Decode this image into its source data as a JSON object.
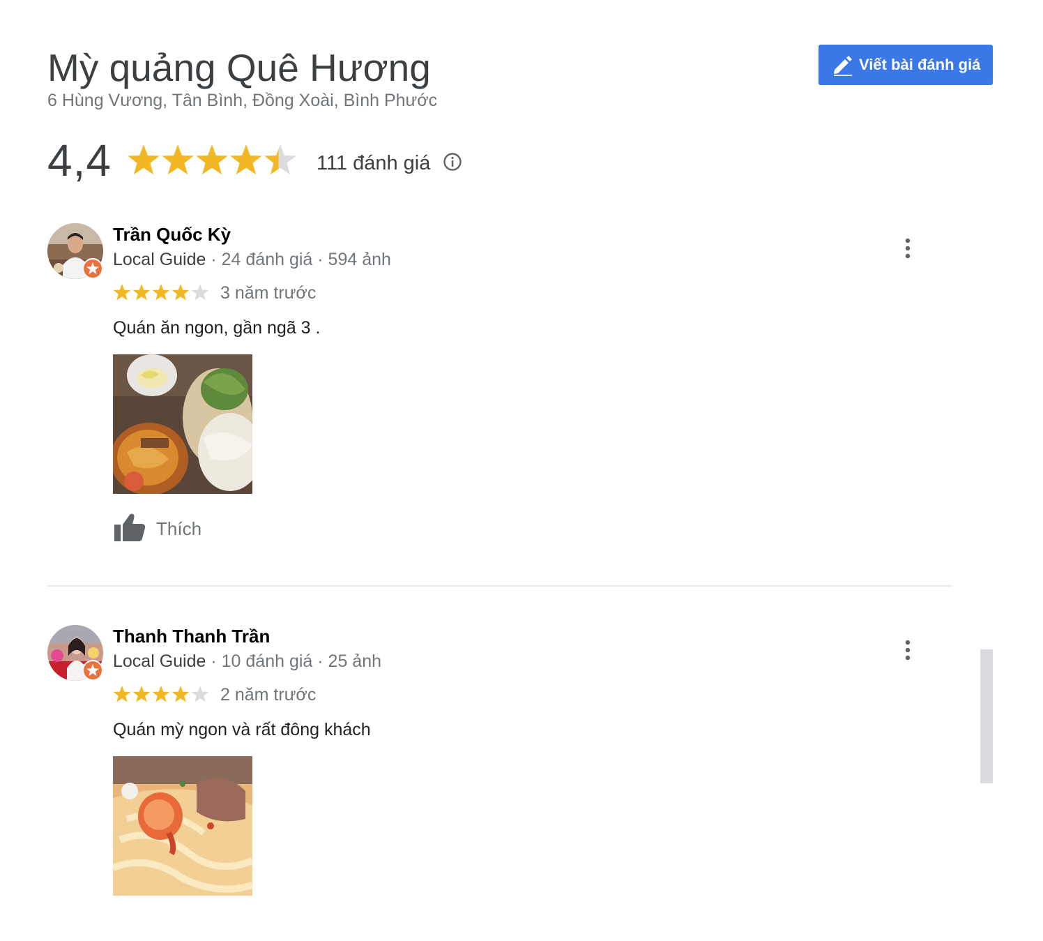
{
  "place": {
    "name": "Mỳ quảng Quê Hương",
    "address": "6 Hùng Vương, Tân Bình, Đồng Xoài, Bình Phước",
    "rating": "4,4",
    "rating_value": 4.4,
    "review_count": "111 đánh giá",
    "info_icon": "info-icon"
  },
  "write_review": {
    "label": "Viết bài đánh giá",
    "icon": "pencil-icon"
  },
  "reviews": [
    {
      "name": "Trần Quốc Kỳ",
      "guide": "Local Guide",
      "stats": " · 24 đánh giá · 594 ảnh",
      "stars": 4,
      "time": "3 năm trước",
      "text": "Quán ăn ngon, gần ngã 3 .",
      "photo": "noodle-bowl-with-lime-and-herbs",
      "like_label": "Thích",
      "like_icon": "thumbs-up-icon"
    },
    {
      "name": "Thanh Thanh Trần",
      "guide": "Local Guide",
      "stats": " · 10 đánh giá · 25 ảnh",
      "stars": 4,
      "time": "2 năm trước",
      "text": "Quán mỳ ngon và rất đông khách",
      "photo": "shrimp-noodle-closeup"
    }
  ],
  "colors": {
    "accent": "#3b78e7",
    "star": "#f2b824",
    "star_empty": "#dadce0",
    "guide_badge": "#e8713c"
  }
}
